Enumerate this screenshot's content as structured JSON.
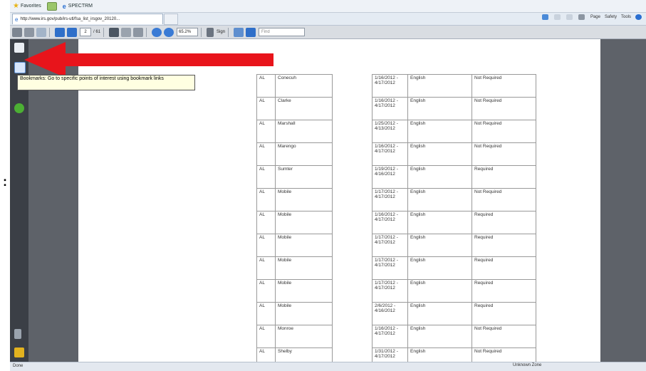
{
  "browser": {
    "favorites_bar": {
      "favorites_label": "Favorites",
      "site_label": "SPECTRM"
    },
    "tab": {
      "url": "http://www.irs.gov/pub/irs-utl/fsa_list_irsgov_20120..."
    },
    "command_bar": {
      "page_label": "Page",
      "safety_label": "Safety",
      "tools_label": "Tools"
    }
  },
  "pdf_toolbar": {
    "page_current": "2",
    "page_total": "/ 61",
    "zoom": "65.2%",
    "sign_label": "Sign",
    "find_placeholder": "Find"
  },
  "tooltip": {
    "text": "Bookmarks: Go to specific points of interest using bookmark links"
  },
  "rows": [
    {
      "state": "AL",
      "county": "Conecuh",
      "dates": "1/16/2012 - 4/17/2012",
      "language": "English",
      "requirement": "Not Required"
    },
    {
      "state": "AL",
      "county": "Clarke",
      "dates": "1/16/2012 - 4/17/2012",
      "language": "English",
      "requirement": "Not Required"
    },
    {
      "state": "AL",
      "county": "Marshall",
      "dates": "1/25/2012 - 4/13/2012",
      "language": "English",
      "requirement": "Not Required"
    },
    {
      "state": "AL",
      "county": "Marengo",
      "dates": "1/16/2012 - 4/17/2012",
      "language": "English",
      "requirement": "Not Required"
    },
    {
      "state": "AL",
      "county": "Sumter",
      "dates": "1/19/2012 - 4/16/2012",
      "language": "English",
      "requirement": "Required"
    },
    {
      "state": "AL",
      "county": "Mobile",
      "dates": "1/17/2012 - 4/17/2012",
      "language": "English",
      "requirement": "Not Required"
    },
    {
      "state": "AL",
      "county": "Mobile",
      "dates": "1/16/2012 - 4/17/2012",
      "language": "English",
      "requirement": "Required"
    },
    {
      "state": "AL",
      "county": "Mobile",
      "dates": "1/17/2012 - 4/17/2012",
      "language": "English",
      "requirement": "Required"
    },
    {
      "state": "AL",
      "county": "Mobile",
      "dates": "1/17/2012 - 4/17/2012",
      "language": "English",
      "requirement": "Required"
    },
    {
      "state": "AL",
      "county": "Mobile",
      "dates": "1/17/2012 - 4/17/2012",
      "language": "English",
      "requirement": "Required"
    },
    {
      "state": "AL",
      "county": "Mobile",
      "dates": "2/6/2012 - 4/16/2012",
      "language": "English",
      "requirement": "Required"
    },
    {
      "state": "AL",
      "county": "Monroe",
      "dates": "1/16/2012 - 4/17/2012",
      "language": "English",
      "requirement": "Not Required"
    },
    {
      "state": "AL",
      "county": "Shelby",
      "dates": "1/31/2012 - 4/17/2012",
      "language": "English",
      "requirement": "Not Required"
    }
  ],
  "status": {
    "left": "Done",
    "zone": "Unknown Zone"
  },
  "colors": {
    "arrow": "#e8141b",
    "panel": "#3b3f46",
    "gutter": "#5e6269"
  },
  "icons": [
    "favorites-star-icon",
    "print-icon",
    "save-icon",
    "bookmark-icon",
    "arrow-icon",
    "hand-tool-icon",
    "zoom-in-icon",
    "paperclip-icon",
    "signature-icon",
    "lock-icon"
  ]
}
